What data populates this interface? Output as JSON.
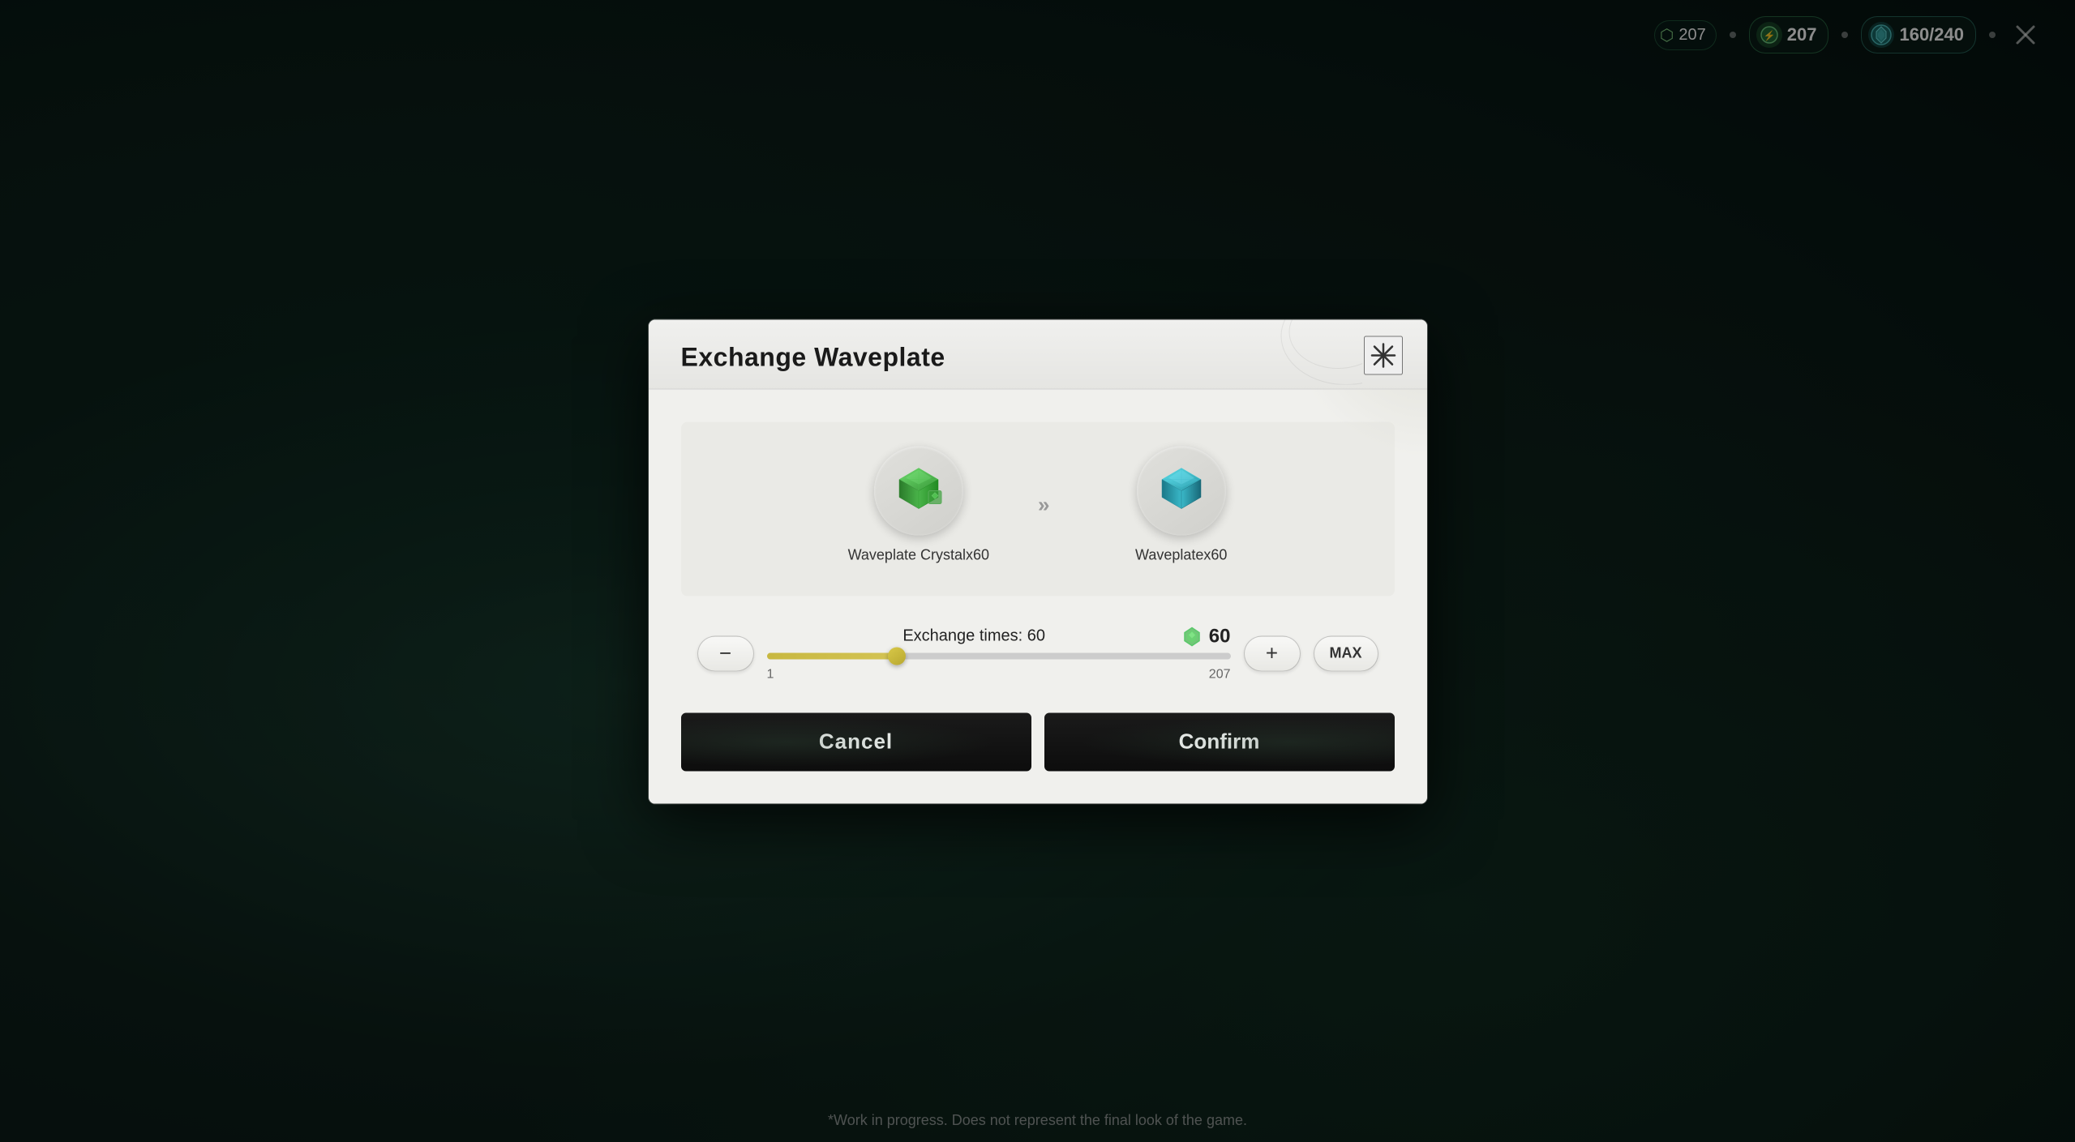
{
  "background": {
    "color": "#0d1f1a"
  },
  "hud": {
    "stamina_value": "207",
    "crystal_value": "160/240",
    "stamina_icon": "⚡",
    "crystal_icon": "💎"
  },
  "modal": {
    "title": "Exchange Waveplate",
    "close_label": "✕",
    "source_item": {
      "label": "Waveplate Crystalx60",
      "icon_color": "#4a9e4a"
    },
    "target_item": {
      "label": "Waveplatex60",
      "icon_color": "#3ab8c8"
    },
    "arrow": "»",
    "exchange_label": "Exchange times: 60",
    "exchange_times": "60",
    "current_amount": "60",
    "slider_min": "1",
    "slider_max": "207",
    "slider_percent": 29,
    "cancel_label": "Cancel",
    "confirm_label": "Confirm",
    "minus_label": "−",
    "plus_label": "+",
    "max_label": "MAX"
  },
  "footer": {
    "note": "*Work in progress. Does not represent the final look of the game."
  }
}
